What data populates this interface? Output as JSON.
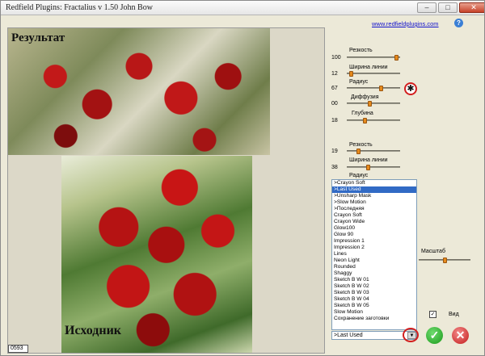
{
  "window": {
    "title": "Redfield Plugins: Fractalius v 1.50    John Bow",
    "minimize_icon": "minimize-icon",
    "maximize_icon": "maximize-icon",
    "close_icon": "close-icon"
  },
  "header": {
    "site_link": "www.redfieldplugins.com",
    "help_icon": "?"
  },
  "preview": {
    "result_caption": "Результат",
    "source_caption": "Исходник",
    "coordinate": "0593"
  },
  "group1": {
    "params": [
      {
        "label": "Резкость",
        "value": "100",
        "level": 0.95
      },
      {
        "label": "Ширина линии",
        "value": "12",
        "level": 0.06
      },
      {
        "label": "Радиус",
        "value": "67",
        "level": 0.67
      },
      {
        "label": "Диффузия",
        "value": "00",
        "level": 0.33
      },
      {
        "label": "Глубина",
        "value": "18",
        "level": 0.18
      }
    ],
    "reset_icon": "✱"
  },
  "group2": {
    "params": [
      {
        "label": "Резкость",
        "value": "19",
        "level": 0.19
      },
      {
        "label": "Ширина линии",
        "value": "38",
        "level": 0.38
      },
      {
        "label": "Радиус",
        "value": "",
        "level": null
      }
    ]
  },
  "presets": {
    "items": [
      ">Crayon Soft",
      ">Last Used",
      ">Unsharp Mask",
      ">Slow Motion",
      ">Последняя",
      "Crayon Soft",
      "Crayon Wide",
      "Glow100",
      "Glow 90",
      "Impression 1",
      "Impression 2",
      "Lines",
      "Neon Light",
      "Rounded",
      "Shaggy",
      "Sketch B W 01",
      "Sketch B W 02",
      "Sketch B W 03",
      "Sketch B W 04",
      "Sketch B W 05",
      "Slow Motion",
      "Сохранение заготовки"
    ],
    "selected_index": 1,
    "combo_value": ">Last Used",
    "combo_arrow": "▼"
  },
  "zoom": {
    "label": "Масштаб",
    "level": 0.5
  },
  "view": {
    "label": "Вид",
    "checked": true,
    "check_mark": "✓"
  },
  "actions": {
    "ok_icon": "✓",
    "cancel_icon": "✕"
  },
  "colors": {
    "slider_thumb": "#e58a1c",
    "highlight_ring": "#d21e1e",
    "selection": "#316ac5",
    "ok_button": "#1a9a1a",
    "cancel_button": "#c21a1a"
  }
}
